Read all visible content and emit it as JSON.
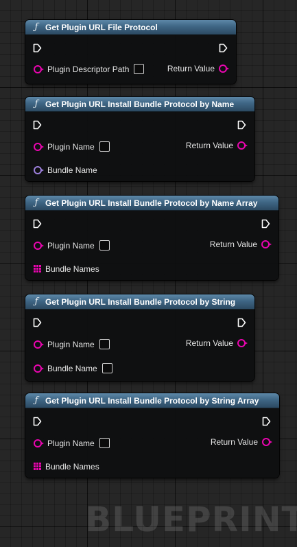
{
  "nodes": [
    {
      "title": "Get Plugin URL File Protocol",
      "inputs": [
        {
          "label": "Plugin Descriptor Path",
          "pin": "string",
          "checkbox": true
        }
      ],
      "output_label": "Return Value"
    },
    {
      "title": "Get Plugin URL Install Bundle Protocol by Name",
      "inputs": [
        {
          "label": "Plugin Name",
          "pin": "string",
          "checkbox": true
        },
        {
          "label": "Bundle Name",
          "pin": "name",
          "checkbox": false
        }
      ],
      "output_label": "Return Value"
    },
    {
      "title": "Get Plugin URL Install Bundle Protocol by Name Array",
      "inputs": [
        {
          "label": "Plugin Name",
          "pin": "string",
          "checkbox": true
        },
        {
          "label": "Bundle Names",
          "pin": "array",
          "checkbox": false
        }
      ],
      "output_label": "Return Value"
    },
    {
      "title": "Get Plugin URL Install Bundle Protocol by String",
      "inputs": [
        {
          "label": "Plugin Name",
          "pin": "string",
          "checkbox": true
        },
        {
          "label": "Bundle Name",
          "pin": "string",
          "checkbox": true
        }
      ],
      "output_label": "Return Value"
    },
    {
      "title": "Get Plugin URL Install Bundle Protocol by String Array",
      "inputs": [
        {
          "label": "Plugin Name",
          "pin": "string",
          "checkbox": true
        },
        {
          "label": "Bundle Names",
          "pin": "array",
          "checkbox": false
        }
      ],
      "output_label": "Return Value"
    }
  ],
  "watermark": "BLUEPRINT",
  "colors": {
    "header": "#3f6685",
    "string_pin": "#ea05b0",
    "name_pin": "#9d80dc",
    "exec_pin": "#ffffff"
  }
}
